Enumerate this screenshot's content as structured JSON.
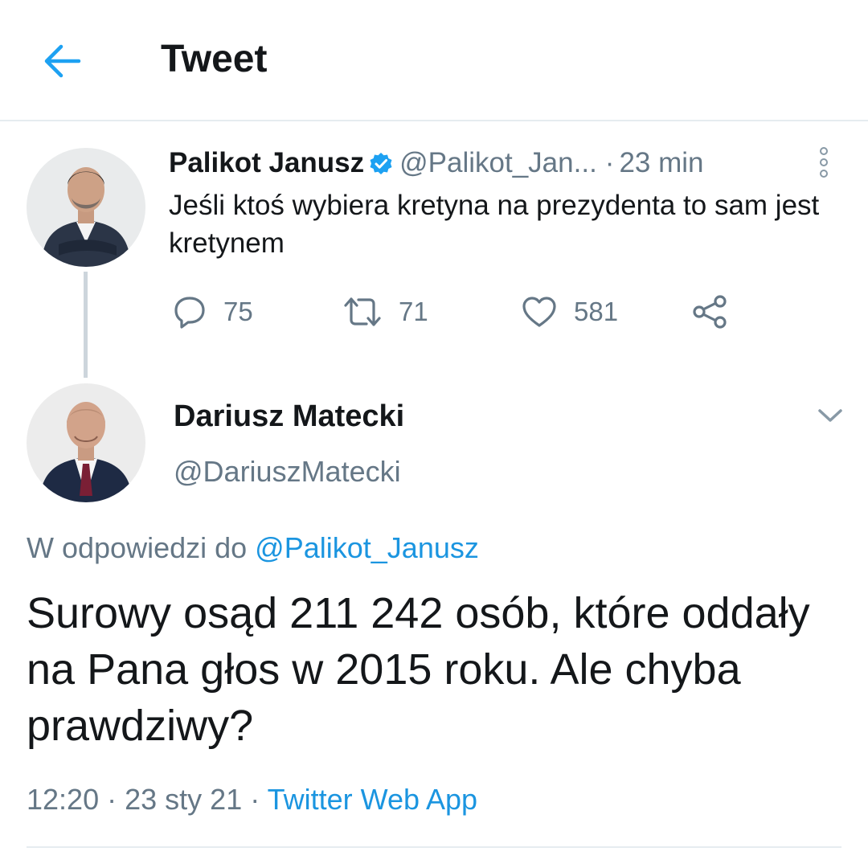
{
  "header": {
    "title": "Tweet",
    "back_icon": "arrow-left-icon"
  },
  "colors": {
    "accent": "#1da1f2",
    "link": "#1b95e0",
    "secondary_text": "#657786",
    "primary_text": "#14171a"
  },
  "tweet1": {
    "name": "Palikot Janusz",
    "verified": true,
    "handle": "@Palikot_Jan...",
    "separator": "·",
    "time": "23 min",
    "text": "Jeśli ktoś wybiera kretyna na prezydenta to sam jest kretynem",
    "actions": {
      "reply_count": "75",
      "retweet_count": "71",
      "like_count": "581"
    }
  },
  "tweet2": {
    "name": "Dariusz Matecki",
    "handle": "@DariuszMatecki",
    "replying_prefix": "W odpowiedzi do",
    "replying_to": "@Palikot_Janusz",
    "text": "Surowy osąd 211 242 osób, które oddały na Pana głos w 2015 roku. Ale chyba prawdziwy?",
    "time": "12:20",
    "date": "23 sty 21",
    "separator": "·",
    "source": "Twitter Web App"
  }
}
